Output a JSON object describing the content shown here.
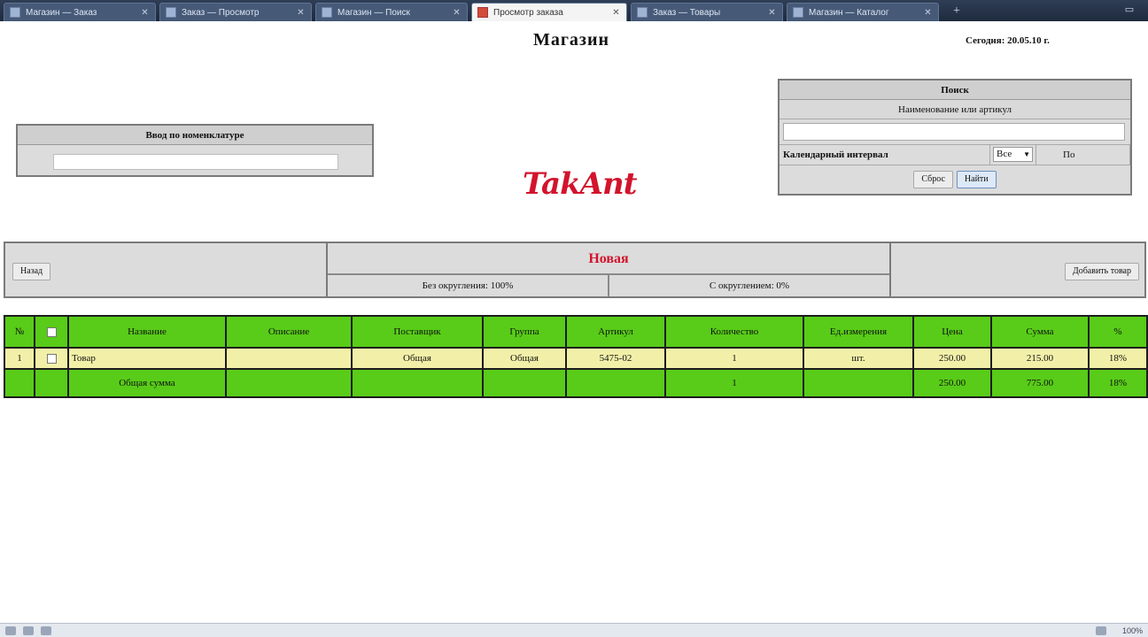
{
  "browser": {
    "tabs": [
      {
        "label": "Магазин — Заказ",
        "active": false
      },
      {
        "label": "Заказ — Просмотр",
        "active": false
      },
      {
        "label": "Магазин — Поиск",
        "active": false
      },
      {
        "label": "Просмотр заказа",
        "active": true
      },
      {
        "label": "Заказ — Товары",
        "active": false
      },
      {
        "label": "Магазин — Каталог",
        "active": false
      }
    ],
    "new_tab": "+",
    "window_button": "▭"
  },
  "header": {
    "title": "Магазин",
    "today": "Сегодня: 20.05.10 г."
  },
  "logo_text": "TakAnt",
  "goto": {
    "title": "Ввод по номенклатуре",
    "value": ""
  },
  "search": {
    "title": "Поиск",
    "name_label": "Наименование или артикул",
    "name_value": "",
    "interval_label": "Календарный интервал",
    "interval_from": "Все",
    "interval_to": "По",
    "clear_button": "Сброс",
    "find_button": "Найти"
  },
  "order": {
    "back_button": "Назад",
    "status": "Новая",
    "margin_label": "Без округления: 100%",
    "discount_label": "С округлением: 0%",
    "add_button": "Добавить товар"
  },
  "table": {
    "headers": [
      "№",
      "",
      "Название",
      "Описание",
      "Поставщик",
      "Группа",
      "Артикул",
      "Количество",
      "Ед.измерения",
      "Цена",
      "Сумма",
      "%"
    ],
    "rows": [
      [
        "1",
        "",
        "Товар",
        "",
        "Общая",
        "Общая",
        "5475-02",
        "1",
        "шт.",
        "250.00",
        "215.00",
        "18%"
      ]
    ],
    "footer": [
      "",
      "",
      "Общая сумма",
      "",
      "",
      "",
      "",
      "1",
      "",
      "250.00",
      "775.00",
      "18%"
    ]
  },
  "statusbar": {
    "zoom": "100%"
  }
}
